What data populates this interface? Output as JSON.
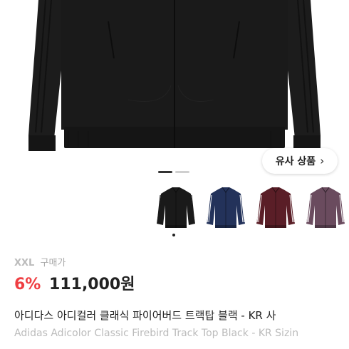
{
  "hero": {
    "similar_button_label": "유사 상품",
    "chevron_icon": "chevron-right-icon",
    "page_indicator": {
      "active": 1,
      "total": 2
    }
  },
  "thumbnails": [
    {
      "name": "black",
      "color": "#1a1a1a",
      "stripe": "#1a1a1a",
      "selected": true
    },
    {
      "name": "navy",
      "color": "#23325a",
      "stripe": "#ffffff",
      "selected": false
    },
    {
      "name": "burgundy",
      "color": "#5a1e27",
      "stripe": "#ffffff",
      "selected": false
    },
    {
      "name": "mauve",
      "color": "#6a4b5e",
      "stripe": "#ffffff",
      "selected": false
    }
  ],
  "product": {
    "size": "XXL",
    "size_label": "구매가",
    "discount": "6%",
    "price": "111,000원",
    "title_ko": "아디다스 아디컬러 클래식 파이어버드 트랙탑 블랙 - KR 사",
    "title_en": "Adidas Adicolor Classic Firebird Track Top Black - KR Sizin"
  }
}
